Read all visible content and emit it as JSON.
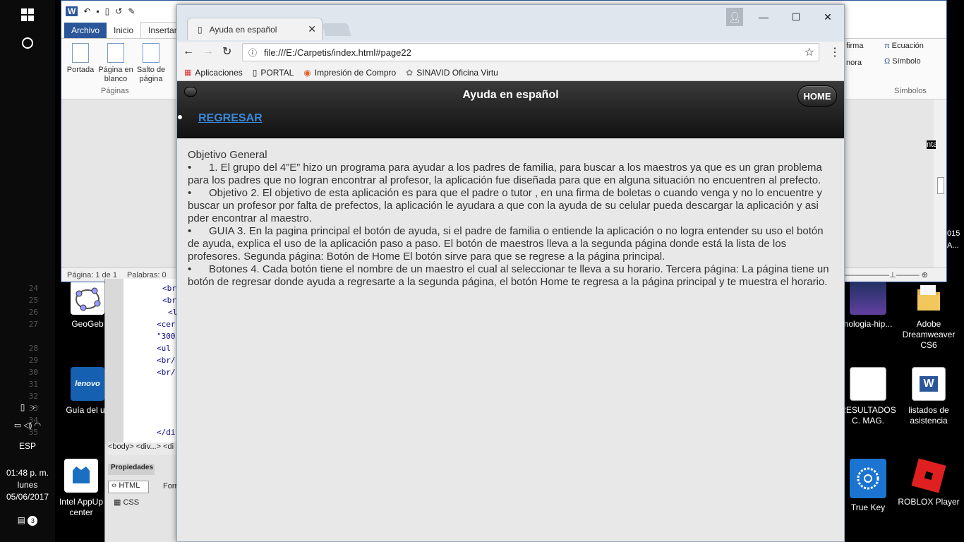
{
  "taskbar": {
    "lang": "ESP",
    "time": "01:48 p. m.",
    "day": "lunes",
    "date": "05/06/2017",
    "notif_count": "3"
  },
  "desktop_icons": [
    {
      "label": "GeoGeb",
      "color": "#3050c0"
    },
    {
      "label": "Guía del us",
      "color": "#1560b0"
    },
    {
      "label": "Intel AppUp center",
      "color": "#0a70c0"
    },
    {
      "label": "nologia-hip...",
      "color": "#302060"
    },
    {
      "label": "RESULTADOS C. MAG.",
      "color": "#ffffff"
    },
    {
      "label": "True Key",
      "color": "#1b75d0"
    },
    {
      "label": "Adobe Dreamweaver CS6",
      "color": "#e8b84a"
    },
    {
      "label": "listados de asistencia",
      "color": "#2b579a"
    },
    {
      "label": "ROBLOX Player",
      "color": "#e02020"
    }
  ],
  "word": {
    "tabs": [
      "Archivo",
      "Inicio",
      "Insertar"
    ],
    "ribbon": {
      "portada": "Portada",
      "pagina_blanco": "Página en blanco",
      "salto": "Salto de página",
      "group_paginas": "Páginas",
      "firma": "firma",
      "nora": "nora",
      "ecuacion": "Ecuación",
      "simbolo": "Símbolo",
      "group_simbolos": "Símbolos"
    },
    "status": {
      "page": "Página: 1 de 1",
      "words": "Palabras: 0"
    },
    "side_text_1": "ntal",
    "side_text_2": "015",
    "side_text_3": "A..."
  },
  "dreamweaver": {
    "lines": [
      {
        "n": "24",
        "code": "<br"
      },
      {
        "n": "25",
        "code": "<br"
      },
      {
        "n": "26",
        "code": "<l"
      },
      {
        "n": "27",
        "code": "<cer"
      },
      {
        "n": "",
        "code": "\"300"
      },
      {
        "n": "28",
        "code": "<ul"
      },
      {
        "n": "29",
        "code": "<br/"
      },
      {
        "n": "30",
        "code": "<br/"
      },
      {
        "n": "31",
        "code": ""
      },
      {
        "n": "32",
        "code": ""
      },
      {
        "n": "33",
        "code": ""
      },
      {
        "n": "34",
        "code": ""
      },
      {
        "n": "35",
        "code": "</di"
      }
    ],
    "breadcrumb": "<body> <div...> <di",
    "panel_title": "Propiedades",
    "html_btn": "HTML",
    "css_btn": "CSS",
    "form_label": "Forr"
  },
  "browser": {
    "tab_title": "Ayuda en español",
    "url": "file:///E:/Carpetis/index.html#page22",
    "bookmarks": [
      "Aplicaciones",
      "PORTAL",
      "Impresión de Compro",
      "SINAVID Oficina Virtu"
    ]
  },
  "page": {
    "header_title": "Ayuda en español",
    "home_label": "HOME",
    "regresar_label": "REGRESAR",
    "heading": "Objetivo General",
    "items": [
      "1. El grupo del 4”E” hizo un programa para ayudar a los padres de familia, para buscar a los maestros ya que es un gran problema para los padres que no logran encontrar al profesor, la aplicación fue diseñada para que en alguna situación no encuentren al prefecto.",
      "Objetivo 2. El objetivo de esta aplicación es para que el padre o tutor , en una firma de boletas o cuando venga y no lo encuentre y buscar un profesor por falta de prefectos, la aplicación le ayudara a que con la ayuda de su celular pueda descargar la aplicación y asi pder encontrar al maestro.",
      "GUIA 3. En la pagina principal el botón de ayuda, si el padre de familia o entiende la aplicación o no logra entender su uso el botón de ayuda, explica el uso de la aplicación paso a paso. El botón de maestros lleva a la segunda página donde está la lista de los profesores. Segunda página: Botón de Home El botón sirve para que se regrese a la página principal.",
      "Botones 4. Cada botón tiene el nombre de un maestro el cual al seleccionar te lleva a su horario. Tercera página: La página tiene un botón de regresar donde ayuda a regresarte a la segunda página, el botón Home te regresa a la página principal y te muestra el horario."
    ]
  }
}
